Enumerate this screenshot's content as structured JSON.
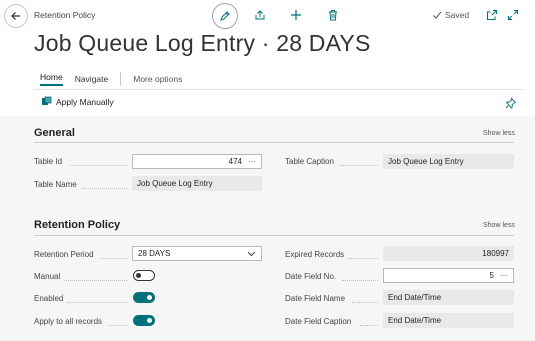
{
  "header": {
    "breadcrumb": "Retention Policy",
    "saved_label": "Saved",
    "title": "Job Queue Log Entry · 28 DAYS"
  },
  "tabs": {
    "home": "Home",
    "navigate": "Navigate",
    "more": "More options"
  },
  "actions": {
    "apply_manually": "Apply Manually"
  },
  "general": {
    "title": "General",
    "show_less": "Show less",
    "table_id_label": "Table Id",
    "table_id_value": "474",
    "table_name_label": "Table Name",
    "table_name_value": "Job Queue Log Entry",
    "table_caption_label": "Table Caption",
    "table_caption_value": "Job Queue Log Entry"
  },
  "retention": {
    "title": "Retention Policy",
    "show_less": "Show less",
    "period_label": "Retention Period",
    "period_value": "28 DAYS",
    "manual_label": "Manual",
    "manual_on": false,
    "enabled_label": "Enabled",
    "enabled_on": true,
    "apply_all_label": "Apply to all records",
    "apply_all_on": true,
    "expired_label": "Expired Records",
    "expired_value": "180997",
    "date_field_no_label": "Date Field No.",
    "date_field_no_value": "5",
    "date_field_name_label": "Date Field Name",
    "date_field_name_value": "End Date/Time",
    "date_field_caption_label": "Date Field Caption",
    "date_field_caption_value": "End Date/Time"
  },
  "colors": {
    "accent": "#00707a",
    "readonly_bg": "#e9e9e9"
  },
  "icons": {
    "back": "back-arrow-icon",
    "edit": "pencil-icon",
    "share": "share-icon",
    "add": "plus-icon",
    "delete": "trash-icon",
    "saved": "checkmark-icon",
    "open_new": "open-in-new-window-icon",
    "expand": "expand-icon",
    "apply": "apply-manually-icon",
    "pin": "pin-icon",
    "dropdown": "chevron-down-icon"
  }
}
